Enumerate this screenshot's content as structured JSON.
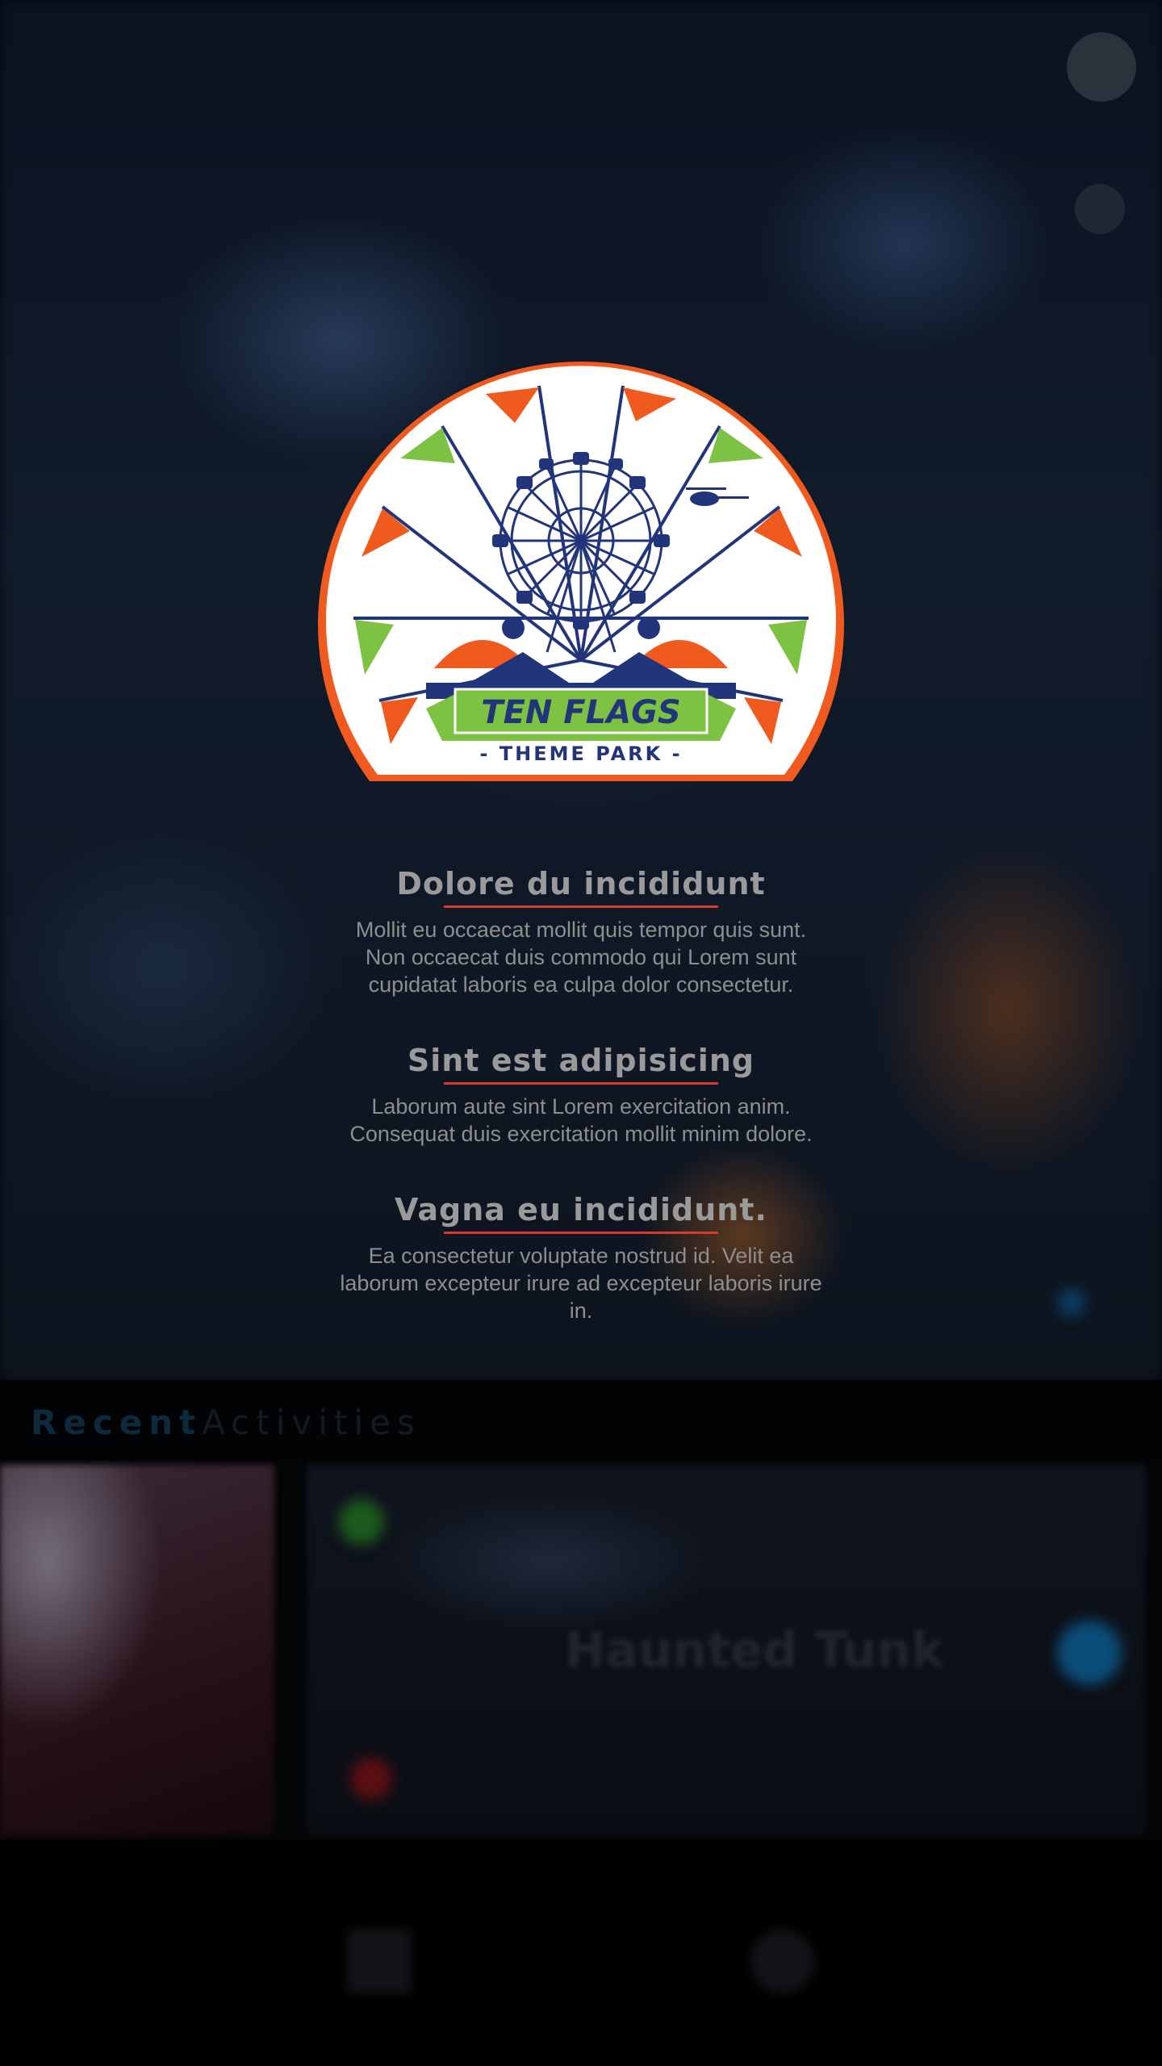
{
  "logo": {
    "brand": "TEN FLAGS",
    "tagline": "- THEME PARK -",
    "colors": {
      "ring": "#f05a1e",
      "banner": "#7dc242",
      "navy": "#23357a"
    }
  },
  "sections": [
    {
      "heading": "Dolore du incididunt",
      "body": "Mollit eu occaecat mollit quis tempor quis sunt. Non occaecat duis commodo qui Lorem sunt cupidatat laboris ea culpa dolor consectetur."
    },
    {
      "heading": "Sint est adipisicing",
      "body": "Laborum aute sint Lorem exercitation anim. Consequat duis exercitation mollit minim dolore."
    },
    {
      "heading": "Vagna eu incididunt.",
      "body": "Ea consectetur voluptate nostrud id. Velit ea laborum excepteur irure ad excepteur laboris irure in."
    }
  ],
  "recent": {
    "title_a": "Recent",
    "title_b": "Activities"
  },
  "card": {
    "title": "Haunted Tunk"
  },
  "colors": {
    "accent_underline": "#d83a2e",
    "overlay": "rgba(0,0,0,0.6)"
  }
}
